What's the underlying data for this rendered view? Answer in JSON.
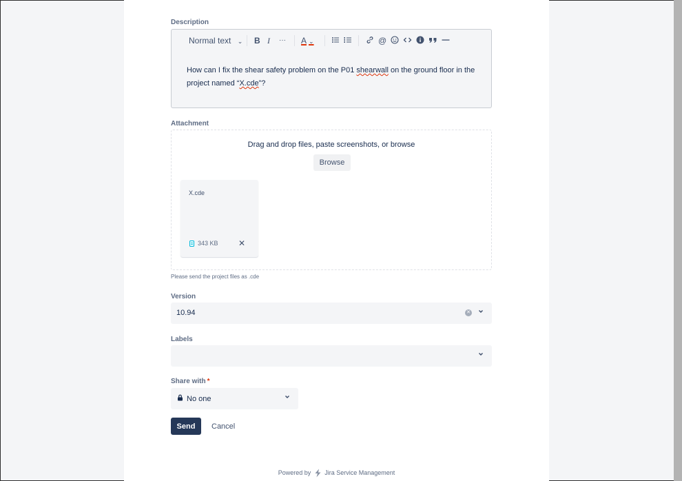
{
  "description": {
    "label": "Description",
    "toolbar": {
      "text_style": "Normal text",
      "bold": "B",
      "italic": "I",
      "more": "···",
      "text_color": "A"
    },
    "body_line1_a": "How can I fix the shear safety problem on the P01 ",
    "body_line1_spell": "shearwall",
    "body_line1_b": " on the ground floor in the",
    "body_line2_a": "project named “",
    "body_line2_spell": "X.cde",
    "body_line2_b": "”?"
  },
  "attachment": {
    "label": "Attachment",
    "drop_text": "Drag and drop files, paste screenshots, or browse",
    "browse_label": "Browse",
    "file": {
      "name": "X.cde",
      "size": "343 KB"
    },
    "helper": "Please send the project files as .cde"
  },
  "version": {
    "label": "Version",
    "value": "10.94"
  },
  "labels_field": {
    "label": "Labels",
    "value": ""
  },
  "share_with": {
    "label": "Share with",
    "required_mark": "*",
    "value": "No one"
  },
  "actions": {
    "send_label": "Send",
    "cancel_label": "Cancel"
  },
  "footer": {
    "prefix": "Powered by",
    "brand": "Jira Service Management"
  },
  "colors": {
    "primary": "#253858",
    "text": "#172b4d",
    "subtle_text": "#5e6c84",
    "field_bg": "#f4f5f7",
    "required": "#de350b"
  }
}
